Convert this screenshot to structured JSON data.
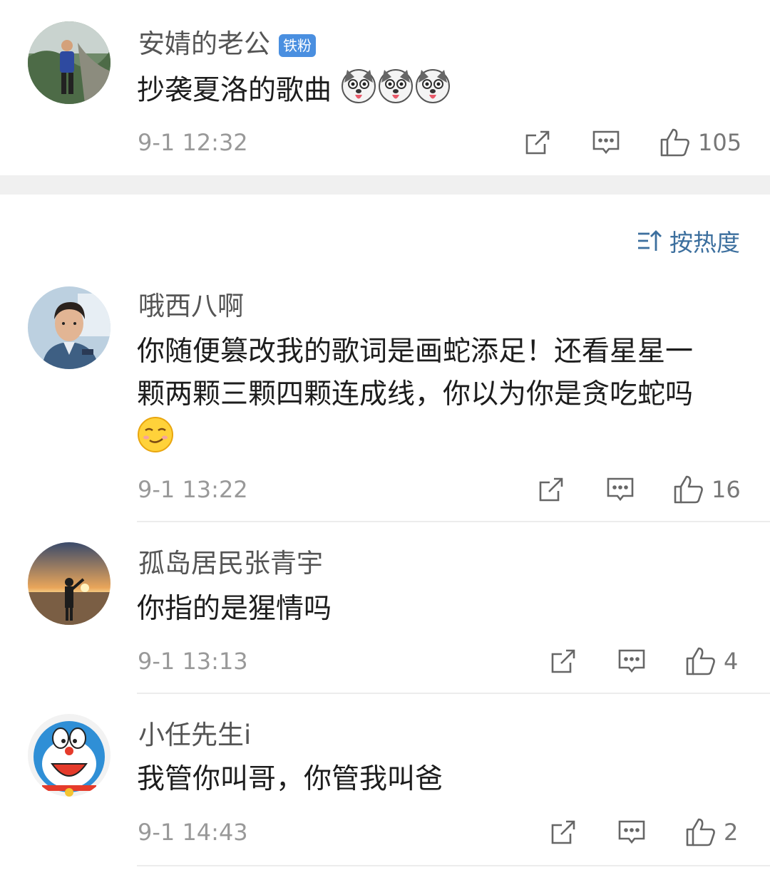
{
  "top_comment": {
    "username": "安婧的老公",
    "badge": "铁粉",
    "text": "抄袭夏洛的歌曲",
    "emojis": [
      "husky-dog-emoji",
      "husky-dog-emoji",
      "husky-dog-emoji"
    ],
    "time": "9-1 12:32",
    "likes": "105"
  },
  "sort": {
    "label": "按热度"
  },
  "replies": [
    {
      "username": "哦西八啊",
      "text_line1": "你随便篡改我的歌词是画蛇添足！还看星星一",
      "text_line2": "颗两颗三颗四颗连成线，你以为你是贪吃蛇吗",
      "emoji": "smirk-emoji",
      "time": "9-1 13:22",
      "likes": "16"
    },
    {
      "username": "孤岛居民张青宇",
      "text": "你指的是猩情吗",
      "time": "9-1 13:13",
      "likes": "4"
    },
    {
      "username": "小任先生i",
      "text": "我管你叫哥，你管我叫爸",
      "time": "9-1 14:43",
      "likes": "2"
    }
  ],
  "colors": {
    "badge": "#4a8fe0",
    "sort_text": "#3c6f9e",
    "separator_band": "#f0f0f0"
  }
}
